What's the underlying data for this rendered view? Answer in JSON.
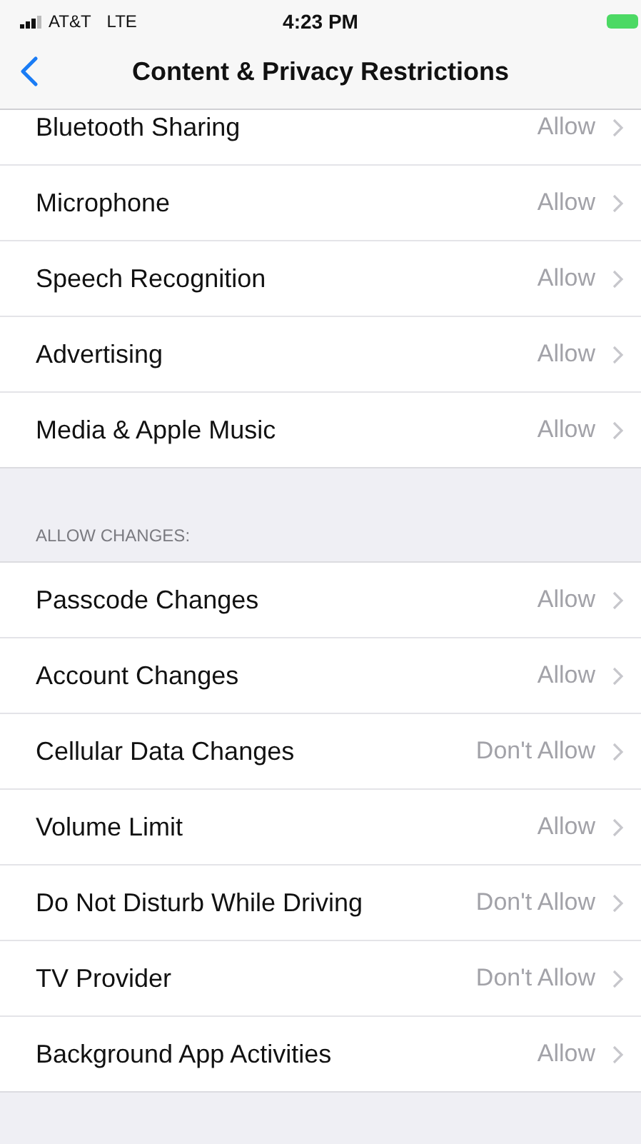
{
  "status_bar": {
    "carrier": "AT&T",
    "network": "LTE",
    "time": "4:23 PM"
  },
  "nav": {
    "title": "Content & Privacy Restrictions"
  },
  "sections": [
    {
      "rows": [
        {
          "label": "Bluetooth Sharing",
          "value": "Allow"
        },
        {
          "label": "Microphone",
          "value": "Allow"
        },
        {
          "label": "Speech Recognition",
          "value": "Allow"
        },
        {
          "label": "Advertising",
          "value": "Allow"
        },
        {
          "label": "Media & Apple Music",
          "value": "Allow"
        }
      ]
    },
    {
      "header": "ALLOW CHANGES:",
      "rows": [
        {
          "label": "Passcode Changes",
          "value": "Allow"
        },
        {
          "label": "Account Changes",
          "value": "Allow"
        },
        {
          "label": "Cellular Data Changes",
          "value": "Don't Allow"
        },
        {
          "label": "Volume Limit",
          "value": "Allow"
        },
        {
          "label": "Do Not Disturb While Driving",
          "value": "Don't Allow"
        },
        {
          "label": "TV Provider",
          "value": "Don't Allow"
        },
        {
          "label": "Background App Activities",
          "value": "Allow"
        }
      ]
    }
  ]
}
